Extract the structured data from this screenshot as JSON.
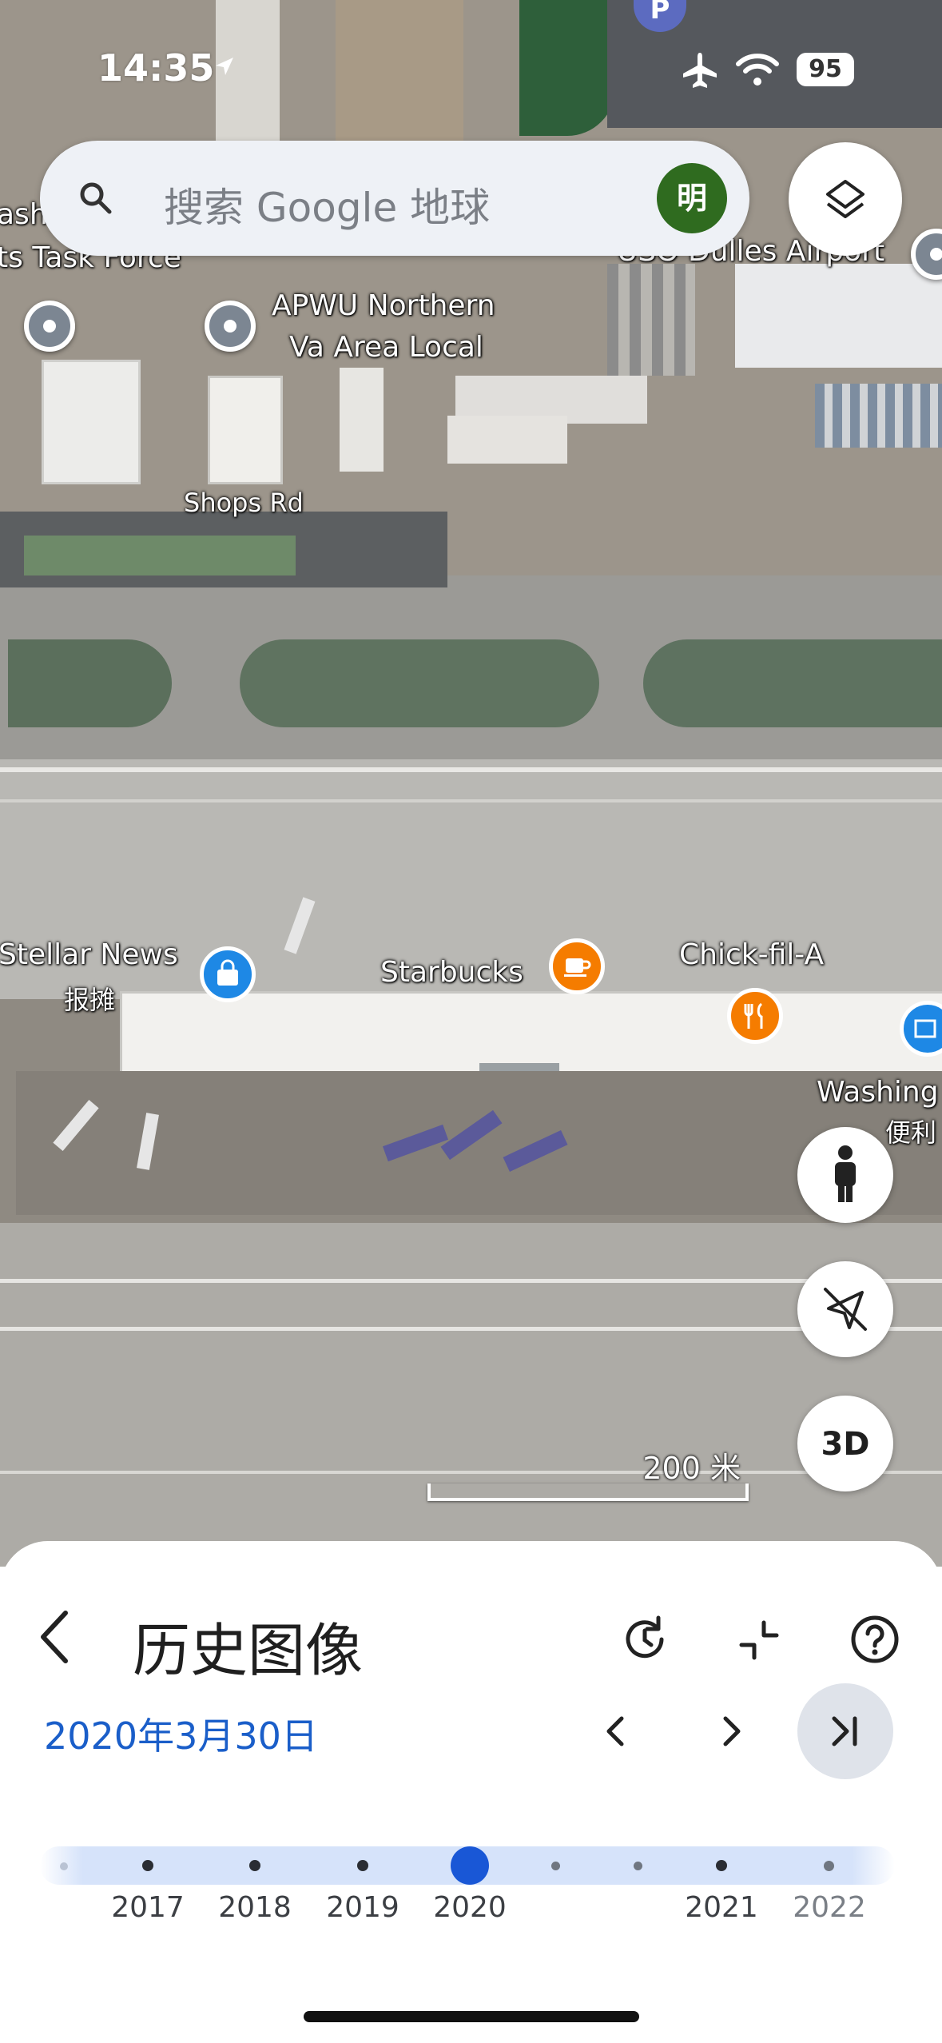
{
  "status_bar": {
    "time": "14:35",
    "battery": "95"
  },
  "search": {
    "placeholder": "搜索 Google 地球",
    "avatar_initial": "明"
  },
  "map": {
    "labels": {
      "ash": "ash",
      "task_force": "ts Task Force",
      "dulles": "USO Dulles Airport",
      "apwu_line1": "APWU Northern",
      "apwu_line2": "Va Area Local",
      "shops_rd": "Shops Rd",
      "stellar_line1": "Stellar News",
      "stellar_line2": "报摊",
      "starbucks": "Starbucks",
      "chickfila": "Chick-fil-A",
      "washing_line1": "Washing",
      "washing_line2": "便利",
      "parking": "P"
    },
    "scale": "200 米",
    "three_d_label": "3D"
  },
  "sheet": {
    "title": "历史图像",
    "date": "2020年3月30日",
    "years": [
      "2017",
      "2018",
      "2019",
      "2020",
      "2021",
      "2022"
    ],
    "selected_year": "2020",
    "colors": {
      "accent": "#1a5ec9",
      "track": "#d6e3fa",
      "selected_dot": "#1957d6"
    }
  }
}
